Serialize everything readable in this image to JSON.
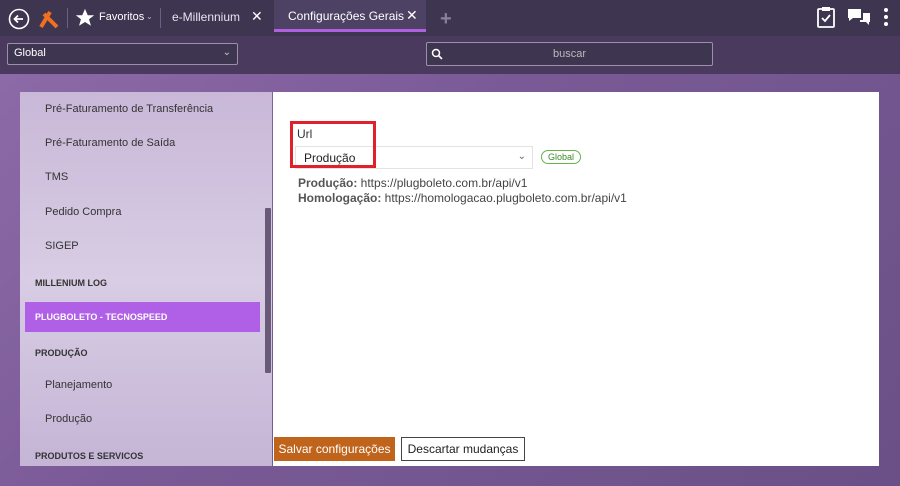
{
  "topbar": {
    "favorites_label": "Favoritos",
    "tabs": [
      {
        "label": "e-Millennium"
      },
      {
        "label": "Configurações Gerais"
      }
    ]
  },
  "toolbar": {
    "scope_select": "Global",
    "search_placeholder": "buscar"
  },
  "sidebar": {
    "items": [
      {
        "label": "Pré-Faturamento de Transferência",
        "type": "sub"
      },
      {
        "label": "Pré-Faturamento de Saída",
        "type": "sub"
      },
      {
        "label": "TMS",
        "type": "sub"
      },
      {
        "label": "Pedido Compra",
        "type": "sub"
      },
      {
        "label": "SIGEP",
        "type": "sub"
      },
      {
        "label": "MILLENIUM LOG",
        "type": "header"
      },
      {
        "label": "PLUGBOLETO - TECNOSPEED",
        "type": "active"
      },
      {
        "label": "PRODUÇÃO",
        "type": "header"
      },
      {
        "label": "Planejamento",
        "type": "sub"
      },
      {
        "label": "Produção",
        "type": "sub"
      },
      {
        "label": "PRODUTOS E SERVICOS",
        "type": "header"
      }
    ]
  },
  "panel": {
    "url_label": "Url",
    "url_value": "Produção",
    "scope_badge": "Global",
    "info": [
      {
        "key": "Produção:",
        "value": " https://plugboleto.com.br/api/v1"
      },
      {
        "key": "Homologação:",
        "value": " https://homologacao.plugboleto.com.br/api/v1"
      }
    ]
  },
  "buttons": {
    "save": "Salvar configurações",
    "discard": "Descartar mudanças"
  },
  "colors": {
    "accent": "#b060e6",
    "save_button": "#c0641c",
    "highlight": "#e0202a"
  }
}
